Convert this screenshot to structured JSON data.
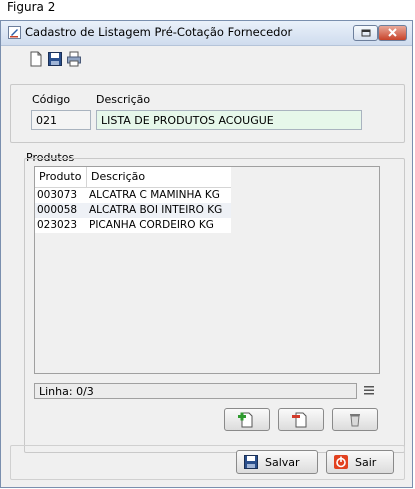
{
  "caption": "Figura 2",
  "window": {
    "title": "Cadastro de Listagem Pré-Cotação Fornecedor",
    "toolbar_icons": [
      "new-document-icon",
      "save-disk-icon",
      "print-icon"
    ]
  },
  "header": {
    "code_label": "Código",
    "description_label": "Descrição",
    "code_value": "021",
    "description_value": "LISTA DE PRODUTOS ACOUGUE"
  },
  "products": {
    "group_label": "Produtos",
    "columns": [
      "Produto",
      "Descrição"
    ],
    "rows": [
      {
        "code": "003073",
        "description": "ALCATRA C MAMINHA KG"
      },
      {
        "code": "000058",
        "description": "ALCATRA BOI INTEIRO KG"
      },
      {
        "code": "023023",
        "description": "PICANHA CORDEIRO KG"
      }
    ],
    "status": "Linha: 0/3"
  },
  "footer": {
    "save_label": "Salvar",
    "exit_label": "Sair"
  },
  "colors": {
    "description_field_bg": "#e6f7ea",
    "exit_icon": "#e2411f"
  }
}
